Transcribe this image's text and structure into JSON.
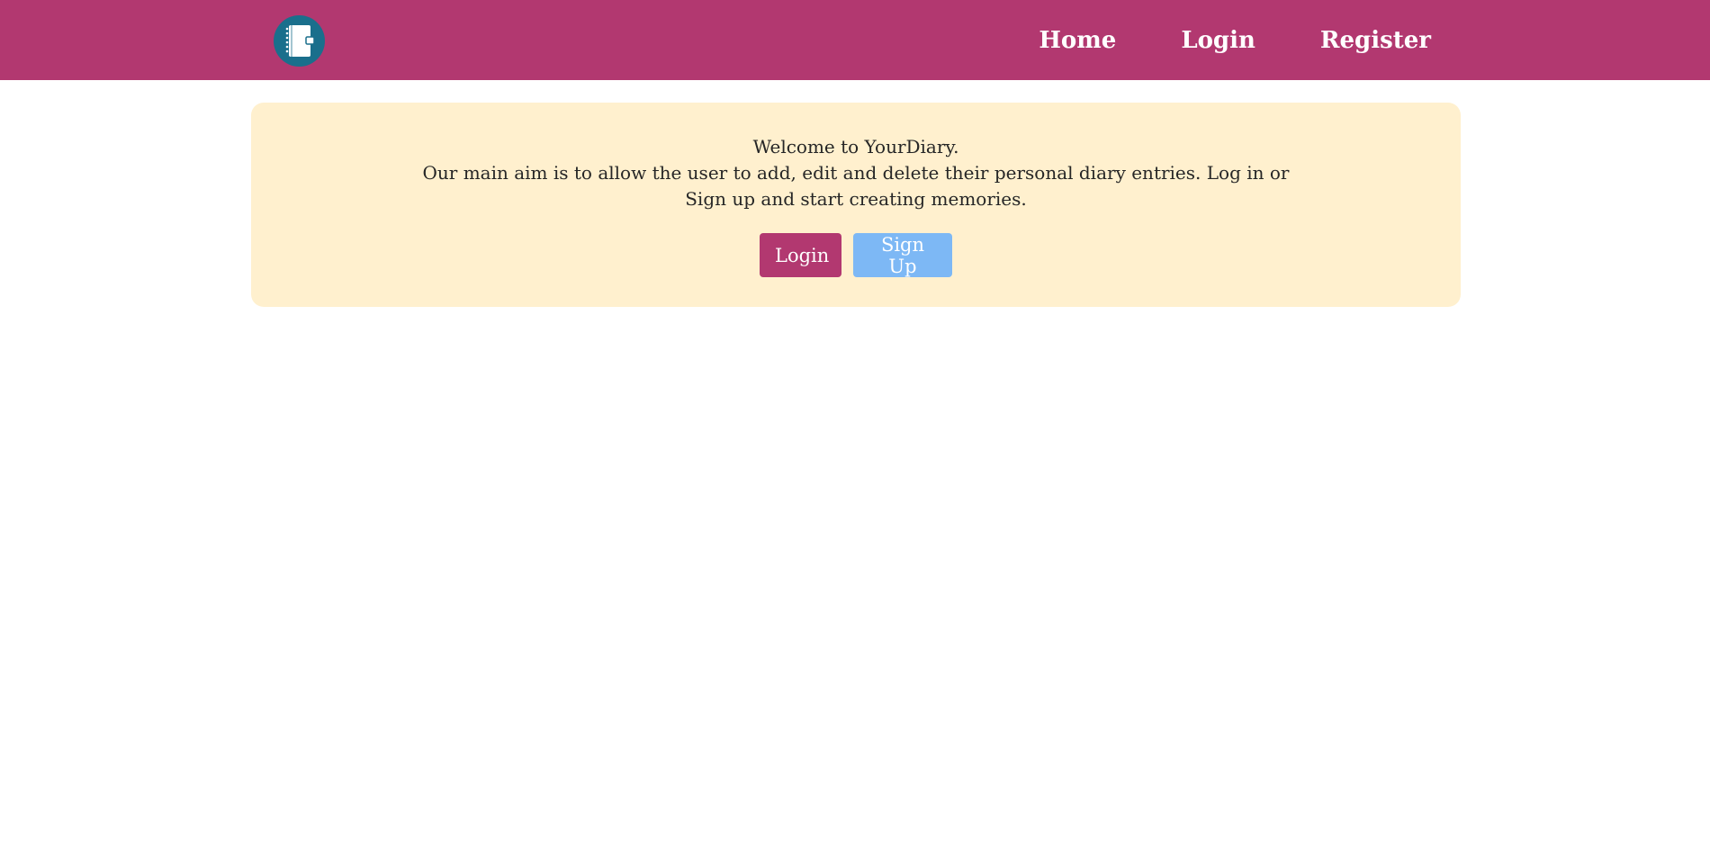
{
  "navbar": {
    "logo_icon": "notebook-icon",
    "links": [
      {
        "label": "Home"
      },
      {
        "label": "Login"
      },
      {
        "label": "Register"
      }
    ],
    "background": "#b23870"
  },
  "welcome": {
    "title": "Welcome to YourDiary.",
    "description": "Our main aim is to allow the user to add, edit and delete their personal diary entries. Log in or Sign up and start creating memories.",
    "login_button": "Login",
    "signup_button": "Sign Up",
    "background": "#fff0ce",
    "login_color": "#b23870",
    "signup_color": "#7db8f5"
  }
}
